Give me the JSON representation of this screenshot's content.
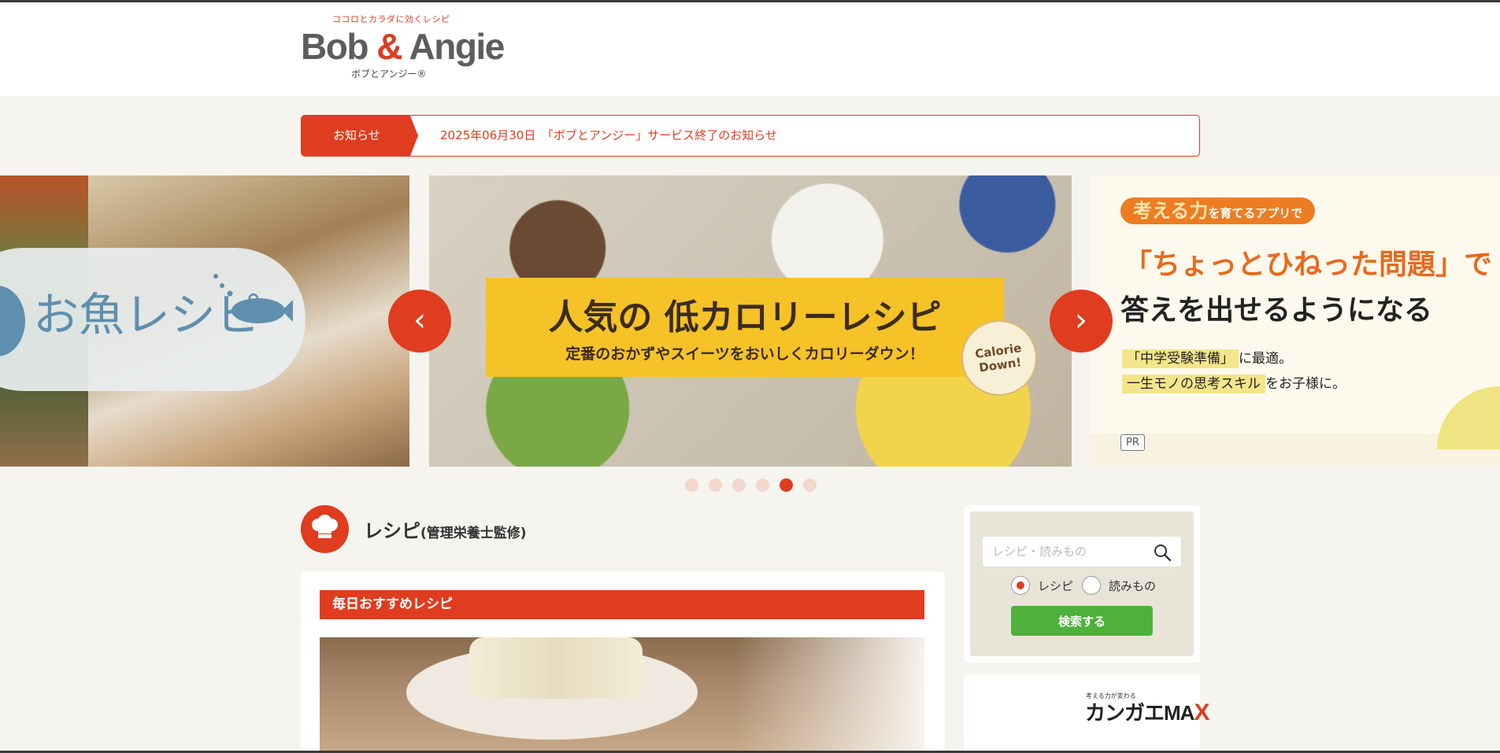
{
  "header": {
    "tagline": "ココロとカラダに効くレシピ",
    "logo_left": "Bob",
    "logo_amp": "&",
    "logo_right": "Angie",
    "logo_sub": "ボブとアンジー®"
  },
  "news": {
    "label": "お知らせ",
    "text": "2025年06月30日　「ボブとアンジー」サービス終了のお知らせ"
  },
  "slider": {
    "left_slide": {
      "title": "お魚レシピ"
    },
    "center_slide": {
      "title": "人気の 低カロリーレシピ",
      "subtitle": "定番のおかずやスイーツをおいしくカロリーダウン！",
      "badge": "Calorie Down!"
    },
    "right_slide": {
      "tag_big": "考える力",
      "tag_small": "を育てるアプリで",
      "headline1": "「ちょっとひねった問題」で",
      "headline2": "答えを出せるようになる",
      "line1_hl": "「中学受験準備」",
      "line1_rest": "に最適。",
      "line2_hl": "一生モノの思考スキル",
      "line2_rest": "をお子様に。",
      "badge": "PR"
    },
    "prev_label": "‹",
    "next_label": "›",
    "dot_count": 6,
    "active_dot": 5
  },
  "recipes": {
    "title": "レシピ",
    "title_sub": "(管理栄養士監修)",
    "bar_label": "毎日おすすめレシピ"
  },
  "search": {
    "placeholder": "レシピ・読みもの",
    "radio_recipe": "レシピ",
    "radio_reading": "読みもの",
    "button": "検索する"
  },
  "ad": {
    "tagline": "考える力が変わる",
    "logo_text": "カンガエMA",
    "logo_x": "X"
  },
  "colors": {
    "accent": "#e03c1f",
    "background": "#f6f4ee",
    "search_button": "#4eb13c"
  }
}
